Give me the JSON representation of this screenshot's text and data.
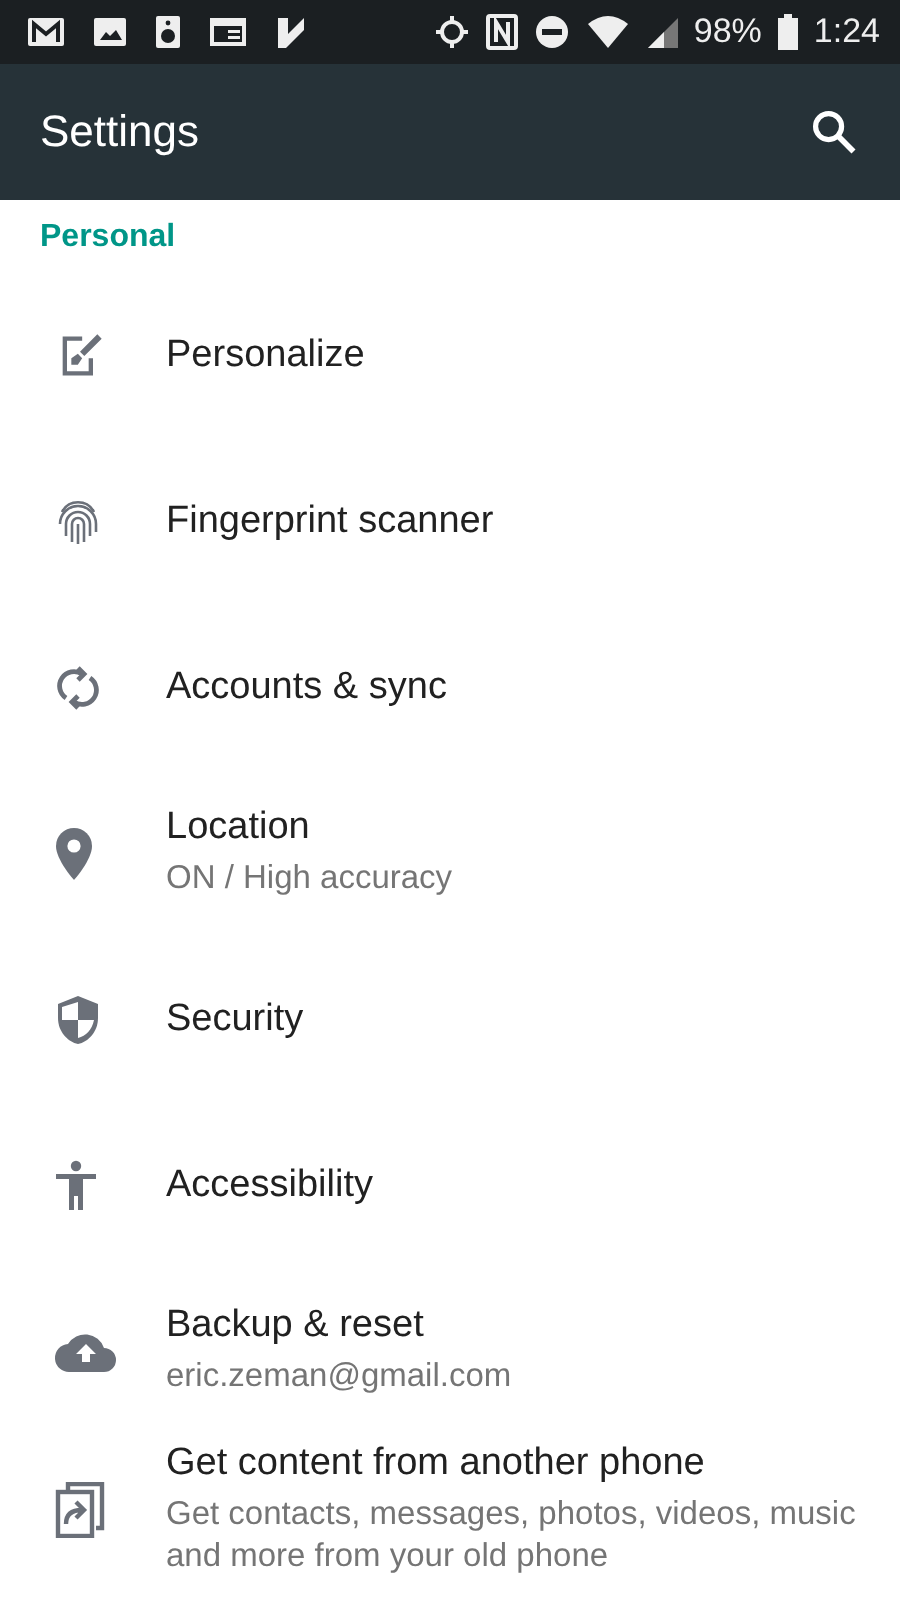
{
  "status_bar": {
    "battery": "98%",
    "time": "1:24"
  },
  "app_bar": {
    "title": "Settings"
  },
  "section": {
    "title": "Personal"
  },
  "items": [
    {
      "title": "Personalize"
    },
    {
      "title": "Fingerprint scanner"
    },
    {
      "title": "Accounts & sync"
    },
    {
      "title": "Location",
      "subtitle": "ON / High accuracy"
    },
    {
      "title": "Security"
    },
    {
      "title": "Accessibility"
    },
    {
      "title": "Backup & reset",
      "subtitle": "eric.zeman@gmail.com"
    },
    {
      "title": "Get content from another phone",
      "subtitle": "Get contacts, messages, photos, videos, music and more from your old phone"
    }
  ]
}
